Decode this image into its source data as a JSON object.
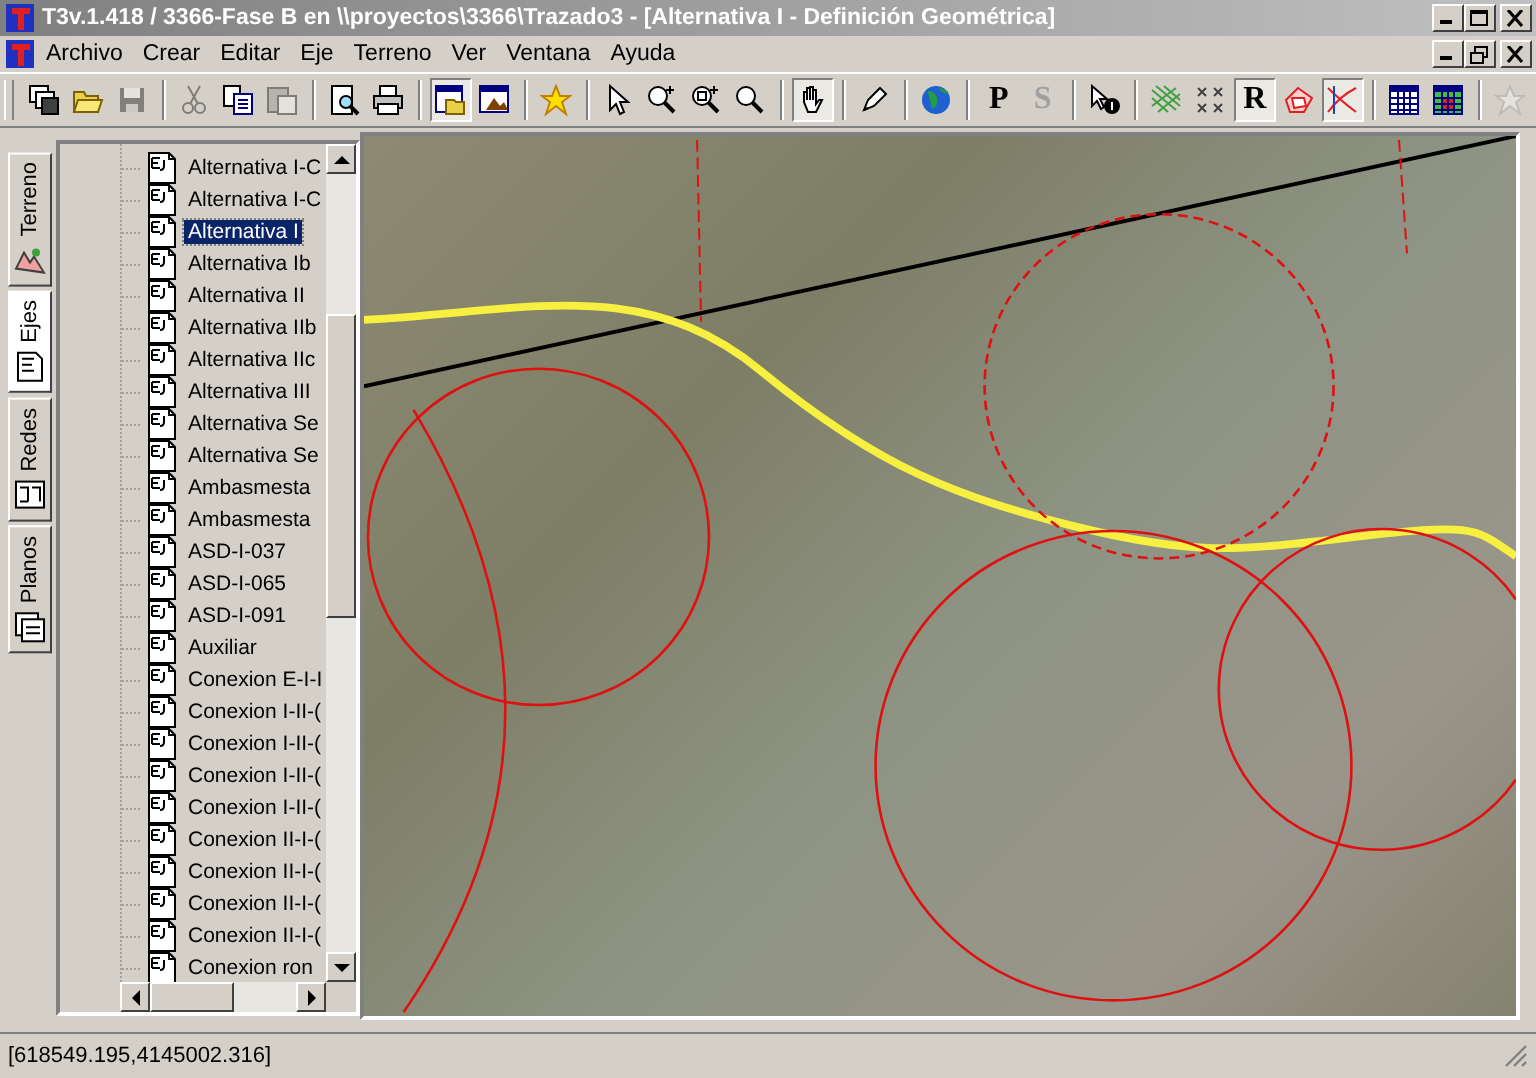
{
  "window": {
    "title": "T3v.1.418 / 3366-Fase B en \\\\proyectos\\3366\\Trazado3 - [Alternativa I - Definición Geométrica]"
  },
  "menu": [
    {
      "label": "Archivo"
    },
    {
      "label": "Crear"
    },
    {
      "label": "Editar"
    },
    {
      "label": "Eje"
    },
    {
      "label": "Terreno"
    },
    {
      "label": "Ver"
    },
    {
      "label": "Ventana"
    },
    {
      "label": "Ayuda"
    }
  ],
  "toolbar": [
    [
      {
        "kind": "icon",
        "pressed": false,
        "disabled": false
      },
      {
        "kind": "icon",
        "pressed": false,
        "disabled": false
      },
      {
        "kind": "icon",
        "pressed": false,
        "disabled": true
      }
    ],
    [
      {
        "kind": "icon",
        "pressed": false,
        "disabled": true
      },
      {
        "kind": "icon",
        "pressed": false,
        "disabled": false
      },
      {
        "kind": "icon",
        "pressed": false,
        "disabled": true
      }
    ],
    [
      {
        "kind": "icon",
        "pressed": false,
        "disabled": false
      },
      {
        "kind": "icon",
        "pressed": false,
        "disabled": false
      }
    ],
    [
      {
        "kind": "icon",
        "pressed": true,
        "disabled": false
      },
      {
        "kind": "icon",
        "pressed": false,
        "disabled": false
      }
    ],
    [
      {
        "kind": "icon",
        "pressed": false,
        "disabled": false
      }
    ],
    [
      {
        "kind": "icon",
        "pressed": false,
        "disabled": false
      },
      {
        "kind": "icon",
        "pressed": false,
        "disabled": false
      },
      {
        "kind": "icon",
        "pressed": false,
        "disabled": false
      },
      {
        "kind": "icon",
        "pressed": false,
        "disabled": false
      }
    ],
    [
      {
        "kind": "icon",
        "pressed": true,
        "disabled": false
      }
    ],
    [
      {
        "kind": "icon",
        "pressed": false,
        "disabled": false
      }
    ],
    [
      {
        "kind": "icon",
        "pressed": false,
        "disabled": false
      }
    ],
    [
      {
        "kind": "letter",
        "label": "P",
        "pressed": false,
        "disabled": false
      },
      {
        "kind": "letter",
        "label": "S",
        "pressed": false,
        "disabled": true
      }
    ],
    [
      {
        "kind": "icon",
        "pressed": false,
        "disabled": false
      }
    ],
    [
      {
        "kind": "icon",
        "pressed": false,
        "disabled": false
      },
      {
        "kind": "icon",
        "pressed": false,
        "disabled": false
      },
      {
        "kind": "letter",
        "label": "R",
        "pressed": true,
        "disabled": false
      },
      {
        "kind": "icon",
        "pressed": false,
        "disabled": false
      },
      {
        "kind": "icon",
        "pressed": true,
        "disabled": false
      }
    ],
    [
      {
        "kind": "icon",
        "pressed": false,
        "disabled": false
      },
      {
        "kind": "icon",
        "pressed": false,
        "disabled": false
      }
    ],
    [
      {
        "kind": "icon",
        "pressed": false,
        "disabled": true
      }
    ]
  ],
  "side_tabs": [
    {
      "label": "Terreno",
      "selected": false
    },
    {
      "label": "Ejes",
      "selected": true
    },
    {
      "label": "Redes",
      "selected": false
    },
    {
      "label": "Planos",
      "selected": false
    }
  ],
  "tree": {
    "items": [
      {
        "label": "Alternativa I-C",
        "selected": false
      },
      {
        "label": "Alternativa I-C",
        "selected": false
      },
      {
        "label": "Alternativa I",
        "selected": true
      },
      {
        "label": "Alternativa Ib",
        "selected": false
      },
      {
        "label": "Alternativa II",
        "selected": false
      },
      {
        "label": "Alternativa IIb",
        "selected": false
      },
      {
        "label": "Alternativa IIc",
        "selected": false
      },
      {
        "label": "Alternativa III",
        "selected": false
      },
      {
        "label": "Alternativa Se",
        "selected": false
      },
      {
        "label": "Alternativa Se",
        "selected": false
      },
      {
        "label": "Ambasmesta",
        "selected": false
      },
      {
        "label": "Ambasmesta",
        "selected": false
      },
      {
        "label": "ASD-I-037",
        "selected": false
      },
      {
        "label": "ASD-I-065",
        "selected": false
      },
      {
        "label": "ASD-I-091",
        "selected": false
      },
      {
        "label": "Auxiliar",
        "selected": false
      },
      {
        "label": "Conexion E-I-I",
        "selected": false
      },
      {
        "label": "Conexion I-II-(",
        "selected": false
      },
      {
        "label": "Conexion I-II-(",
        "selected": false
      },
      {
        "label": "Conexion I-II-(",
        "selected": false
      },
      {
        "label": "Conexion I-II-(",
        "selected": false
      },
      {
        "label": "Conexion II-I-(",
        "selected": false
      },
      {
        "label": "Conexion II-I-(",
        "selected": false
      },
      {
        "label": "Conexion II-I-(",
        "selected": false
      },
      {
        "label": "Conexion II-I-(",
        "selected": false
      },
      {
        "label": "Conexion ron",
        "selected": false
      }
    ]
  },
  "status_bar": {
    "coordinates": "[618549.195,4145002.316]"
  }
}
